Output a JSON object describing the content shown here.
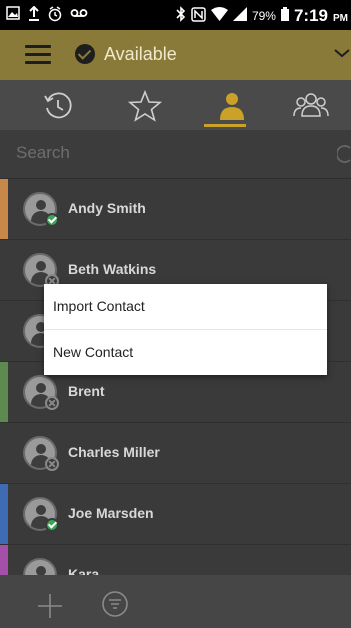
{
  "status_bar": {
    "battery": "79%",
    "time": "7:19",
    "ampm": "PM"
  },
  "header": {
    "presence_label": "Available"
  },
  "tabs": [
    {
      "name": "recent",
      "icon": "history-icon"
    },
    {
      "name": "favorites",
      "icon": "star-icon"
    },
    {
      "name": "contacts",
      "icon": "person-icon",
      "selected": true
    },
    {
      "name": "groups",
      "icon": "group-icon"
    }
  ],
  "search": {
    "placeholder": "Search"
  },
  "contacts": [
    {
      "name": "Andy Smith",
      "presence": "online",
      "stripe": "#c8884a"
    },
    {
      "name": "Beth Watkins",
      "presence": "offline",
      "stripe": ""
    },
    {
      "name": "",
      "presence": "offline",
      "stripe": ""
    },
    {
      "name": "Brent",
      "presence": "offline",
      "stripe": "#5d8a4e"
    },
    {
      "name": "Charles Miller",
      "presence": "offline",
      "stripe": ""
    },
    {
      "name": "Joe Marsden",
      "presence": "online",
      "stripe": "#3f6bb5"
    },
    {
      "name": "Kara",
      "presence": "offline",
      "stripe": "#a44fa8"
    }
  ],
  "popup_menu": {
    "items": [
      "Import Contact",
      "New Contact"
    ]
  },
  "colors": {
    "header_bg": "#8a7a3a",
    "accent": "#c9a227",
    "online": "#3aa655"
  }
}
